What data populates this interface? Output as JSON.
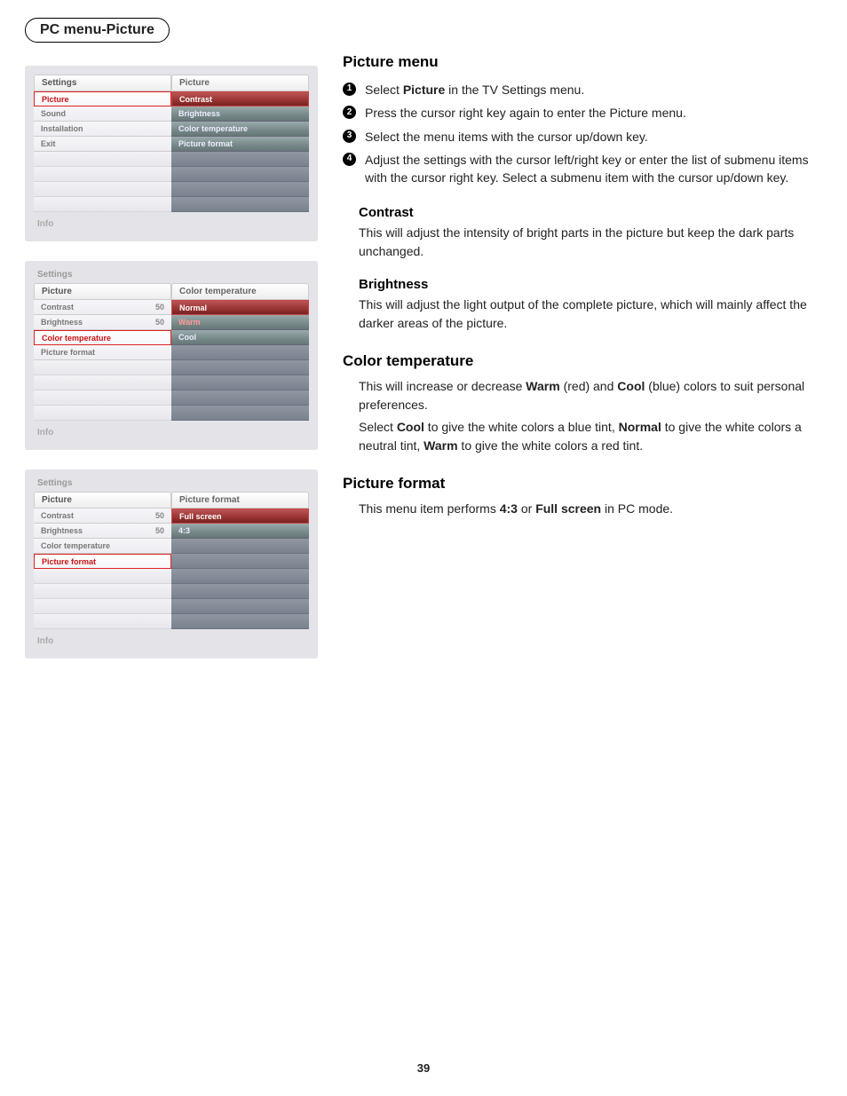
{
  "labels": {
    "box_title": "PC menu-Picture",
    "settings": "Settings",
    "info": "Info",
    "page_number": "39"
  },
  "osd1": {
    "left_head": "Settings",
    "left_rows": [
      "Picture",
      "Sound",
      "Installation",
      "Exit"
    ],
    "left_selected": 0,
    "right_head": "Picture",
    "right_rows": [
      "Contrast",
      "Brightness",
      "Color temperature",
      "Picture format"
    ],
    "right_selected": 0,
    "left_empty": 4,
    "right_empty": 4
  },
  "osd2": {
    "top_label": "Settings",
    "left_head": "Picture",
    "left_rows": [
      [
        "Contrast",
        "50"
      ],
      [
        "Brightness",
        "50"
      ],
      [
        "Color temperature",
        ""
      ],
      [
        "Picture format",
        ""
      ]
    ],
    "left_selected": 2,
    "right_head": "Color temperature",
    "right_rows": [
      "Normal",
      "Warm",
      "Cool"
    ],
    "right_selected": 0,
    "right_warm_index": 1,
    "left_empty": 4,
    "right_empty": 5
  },
  "osd3": {
    "top_label": "Settings",
    "left_head": "Picture",
    "left_rows": [
      [
        "Contrast",
        "50"
      ],
      [
        "Brightness",
        "50"
      ],
      [
        "Color temperature",
        ""
      ],
      [
        "Picture format",
        ""
      ]
    ],
    "left_selected": 3,
    "right_head": "Picture format",
    "right_rows": [
      "Full screen",
      "4:3"
    ],
    "right_selected": 0,
    "left_empty": 4,
    "right_empty": 6
  },
  "content": {
    "picture_menu": {
      "title": "Picture menu",
      "steps": [
        {
          "pre": "Select ",
          "bold": "Picture",
          "post": " in the TV Settings menu."
        },
        {
          "text": "Press the cursor right key again to enter the Picture menu."
        },
        {
          "text": "Select the menu items with the cursor up/down key."
        },
        {
          "text": "Adjust the settings with the cursor left/right key or enter the list of submenu items with the cursor right key. Select a submenu item with the cursor up/down key."
        }
      ]
    },
    "contrast": {
      "title": "Contrast",
      "body": "This will adjust the intensity of bright parts in the picture but keep the dark parts unchanged."
    },
    "brightness": {
      "title": "Brightness",
      "body": "This will adjust the light output of the complete picture, which will mainly affect the darker areas of the picture."
    },
    "color_temp": {
      "title": "Color temperature",
      "p1": {
        "a": "This will increase or decrease ",
        "w": "Warm",
        "b": " (red) and ",
        "c": "Cool",
        "d": " (blue) colors to suit personal preferences."
      },
      "p2": {
        "a": "Select ",
        "c": "Cool",
        "b": " to give the white colors a blue tint, ",
        "n": "Normal",
        "d": " to give the white colors a neutral tint, ",
        "w": "Warm",
        "e": " to give the white colors a red tint."
      }
    },
    "picture_format": {
      "title": "Picture format",
      "p": {
        "a": "This menu item performs ",
        "b1": "4:3",
        "b": " or ",
        "b2": "Full screen",
        "c": " in PC mode."
      }
    }
  }
}
